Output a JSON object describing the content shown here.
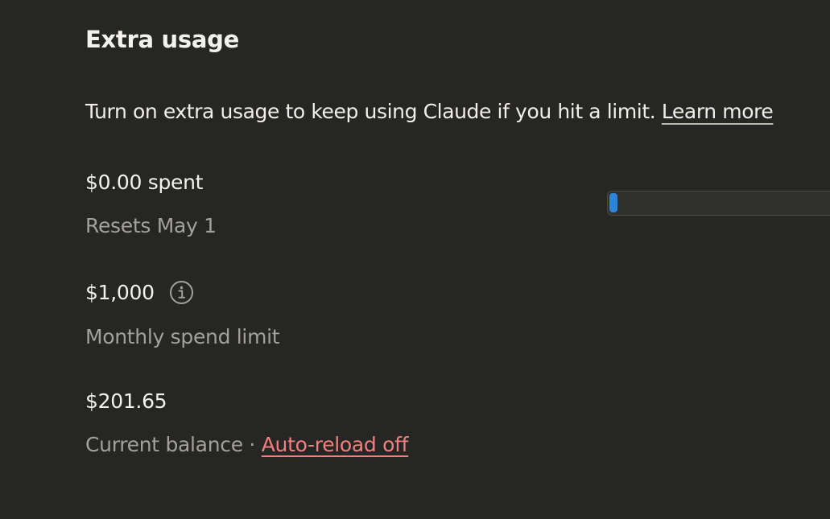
{
  "section": {
    "title": "Extra usage",
    "description": "Turn on extra usage to keep using Claude if you hit a limit.",
    "learn_more_label": "Learn more"
  },
  "spent": {
    "value": "$0.00 spent",
    "reset_text": "Resets May 1",
    "progress_fraction": 0.0,
    "bar_color": "#2c84db"
  },
  "limit": {
    "value": "$1,000",
    "label": "Monthly spend limit",
    "icon": "info-icon"
  },
  "balance": {
    "value": "$201.65",
    "label": "Current balance",
    "separator": " · ",
    "auto_reload_label": "Auto-reload off",
    "auto_reload_color": "#f08080"
  }
}
